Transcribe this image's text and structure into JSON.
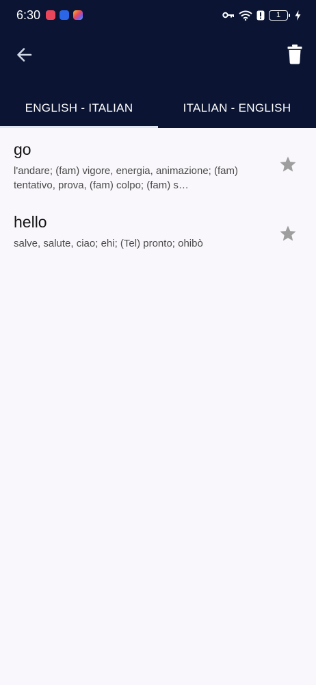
{
  "status_bar": {
    "time": "6:30",
    "battery_level": "1",
    "app_icons": [
      "red-square-app-icon",
      "blue-bulb-app-icon",
      "colorful-app-icon"
    ],
    "icons": [
      "key-icon",
      "wifi-icon",
      "alert-icon",
      "battery-icon",
      "charging-bolt-icon"
    ]
  },
  "toolbar": {
    "back_icon": "arrow-left-icon",
    "delete_icon": "trash-icon"
  },
  "tabs": [
    {
      "label": "ENGLISH - ITALIAN",
      "active": true
    },
    {
      "label": "ITALIAN - ENGLISH",
      "active": false
    }
  ],
  "entries": [
    {
      "word": "go",
      "meaning": "l'andare; (fam) vigore, energia, animazione; (fam) tentativo, prova, (fam) colpo; (fam) s…",
      "star_icon": "star-icon"
    },
    {
      "word": "hello",
      "meaning": "salve, salute, ciao; ehi; (Tel) pronto; ohibò",
      "star_icon": "star-icon"
    }
  ],
  "colors": {
    "header_bg": "#0b1533",
    "body_bg": "#f9f7fb",
    "tab_indicator": "#dfe6f2",
    "star": "#9e9e9e"
  }
}
